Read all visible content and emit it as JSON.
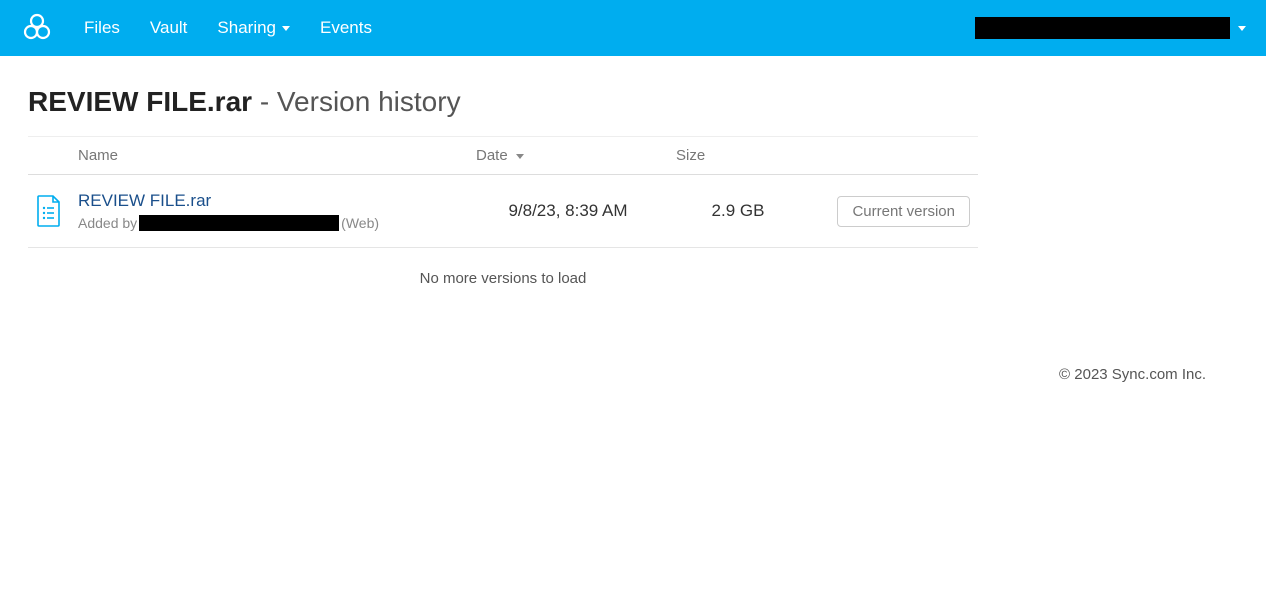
{
  "nav": {
    "files": "Files",
    "vault": "Vault",
    "sharing": "Sharing",
    "events": "Events"
  },
  "page": {
    "filename": "REVIEW FILE.rar",
    "suffix": " - Version history"
  },
  "table": {
    "headers": {
      "name": "Name",
      "date": "Date",
      "size": "Size"
    }
  },
  "versions": [
    {
      "name": "REVIEW FILE.rar",
      "added_by_prefix": "Added by ",
      "added_by_suffix": " (Web)",
      "date": "9/8/23, 8:39 AM",
      "size": "2.9 GB",
      "action": "Current version"
    }
  ],
  "no_more": "No more versions to load",
  "footer": "© 2023 Sync.com Inc."
}
